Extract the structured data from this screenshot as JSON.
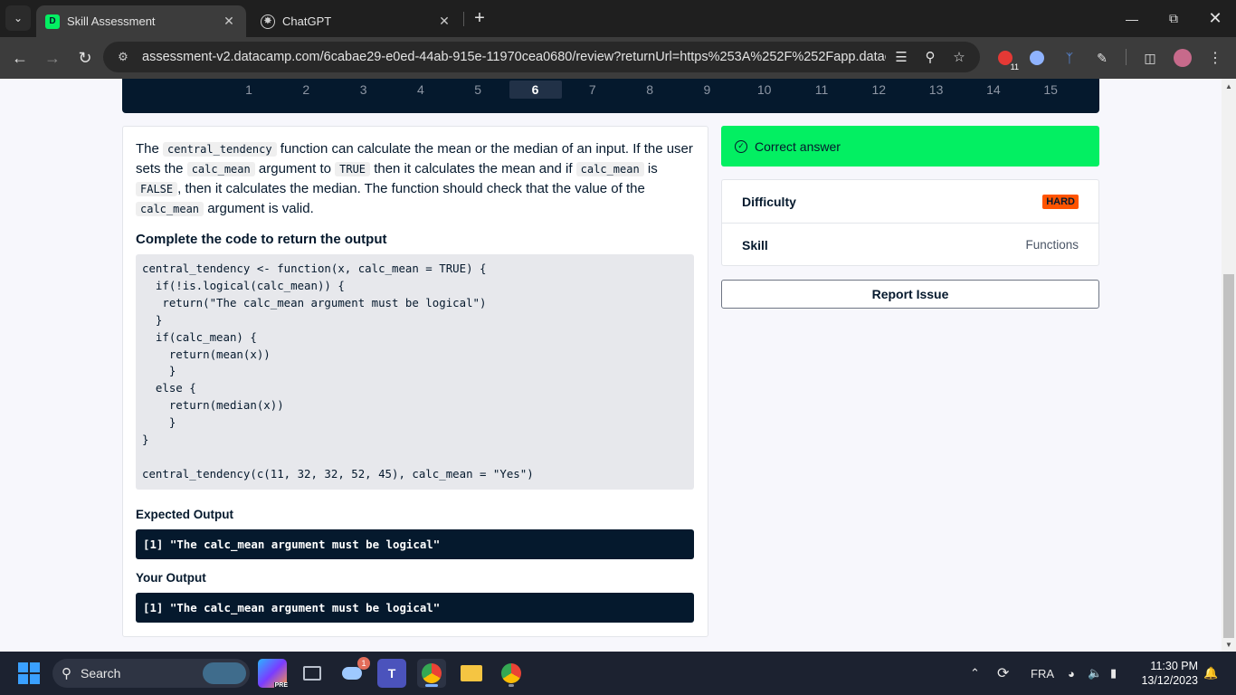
{
  "browser": {
    "tabs": [
      {
        "title": "Skill Assessment",
        "favicon": "datacamp-icon",
        "active": true
      },
      {
        "title": "ChatGPT",
        "favicon": "chatgpt-icon",
        "active": false
      }
    ],
    "url": "assessment-v2.datacamp.com/6cabae29-e0ed-44ab-915e-11970cea0680/review?returnUrl=https%253A%252F%252Fapp.datacamp...",
    "extension_badge": "11"
  },
  "question_nav": {
    "numbers": [
      "1",
      "2",
      "3",
      "4",
      "5",
      "6",
      "7",
      "8",
      "9",
      "10",
      "11",
      "12",
      "13",
      "14",
      "15"
    ],
    "active_index": 5
  },
  "question": {
    "desc": {
      "p1": "The ",
      "c1": "central_tendency",
      "p2": " function can calculate the mean or the median of an input. If the user sets the ",
      "c2": "calc_mean",
      "p3": " argument to ",
      "c3": "TRUE",
      "p4": " then it calculates the mean and if ",
      "c4": "calc_mean",
      "p5": " is ",
      "c5": "FALSE",
      "p6": ", then it calculates the median. The function should check that the value of the ",
      "c6": "calc_mean",
      "p7": " argument is valid."
    },
    "prompt": "Complete the code to return the output",
    "code": "central_tendency <- function(x, calc_mean = TRUE) {\n  if(!is.logical(calc_mean)) {\n   return(\"The calc_mean argument must be logical\")\n  }\n  if(calc_mean) {\n    return(mean(x))\n    }\n  else {\n    return(median(x))\n    }\n}\n\ncentral_tendency(c(11, 32, 32, 52, 45), calc_mean = \"Yes\")",
    "expected_label": "Expected Output",
    "expected_output": "[1] \"The calc_mean argument must be logical\"",
    "your_label": "Your Output",
    "your_output": "[1] \"The calc_mean argument must be logical\""
  },
  "result": {
    "status": "Correct answer",
    "difficulty_label": "Difficulty",
    "difficulty_value": "HARD",
    "skill_label": "Skill",
    "skill_value": "Functions",
    "report_button": "Report Issue"
  },
  "taskbar": {
    "search_placeholder": "Search",
    "language": "FRA",
    "time": "11:30 PM",
    "date": "13/12/2023",
    "weather_badge": "1"
  },
  "colors": {
    "navy": "#05192d",
    "green": "#03ef62",
    "hard_badge": "#ff5400"
  }
}
